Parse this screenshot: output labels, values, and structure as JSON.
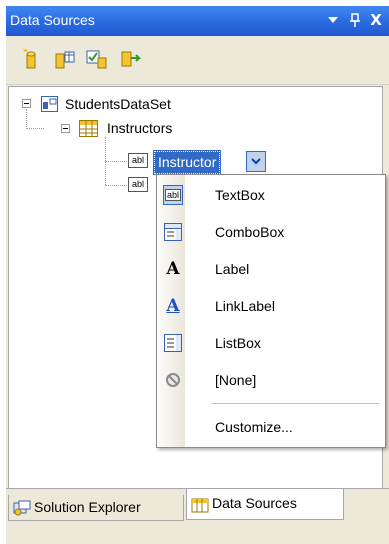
{
  "window": {
    "title": "Data Sources",
    "controls": {
      "dropdown": "▾",
      "pin": "ꟷ",
      "close": "X"
    }
  },
  "toolbar": {
    "icons": [
      "add-new-data-source-icon",
      "edit-dataset-icon",
      "configure-dataset-icon",
      "refresh-icon"
    ]
  },
  "tree": {
    "root": "StudentsDataSet",
    "table": "Instructors",
    "fields": [
      {
        "icon": "abl",
        "label": "Instructor",
        "selected": true
      },
      {
        "icon": "abl",
        "label": ""
      }
    ]
  },
  "menu": {
    "items": [
      {
        "label": "TextBox",
        "icon": "abl",
        "checked": true
      },
      {
        "label": "ComboBox",
        "icon": "combobox-icon"
      },
      {
        "label": "Label",
        "icon": "A"
      },
      {
        "label": "LinkLabel",
        "icon": "A"
      },
      {
        "label": "ListBox",
        "icon": "listbox-icon"
      },
      {
        "label": "[None]",
        "icon": "none-icon"
      }
    ],
    "customize": "Customize..."
  },
  "tabs": [
    {
      "label": "Solution Explorer",
      "active": false
    },
    {
      "label": "Data Sources",
      "active": true
    }
  ],
  "colors": {
    "titlebar": "#2a6ae0",
    "selection": "#316ac5",
    "panel": "#ece9d8"
  }
}
